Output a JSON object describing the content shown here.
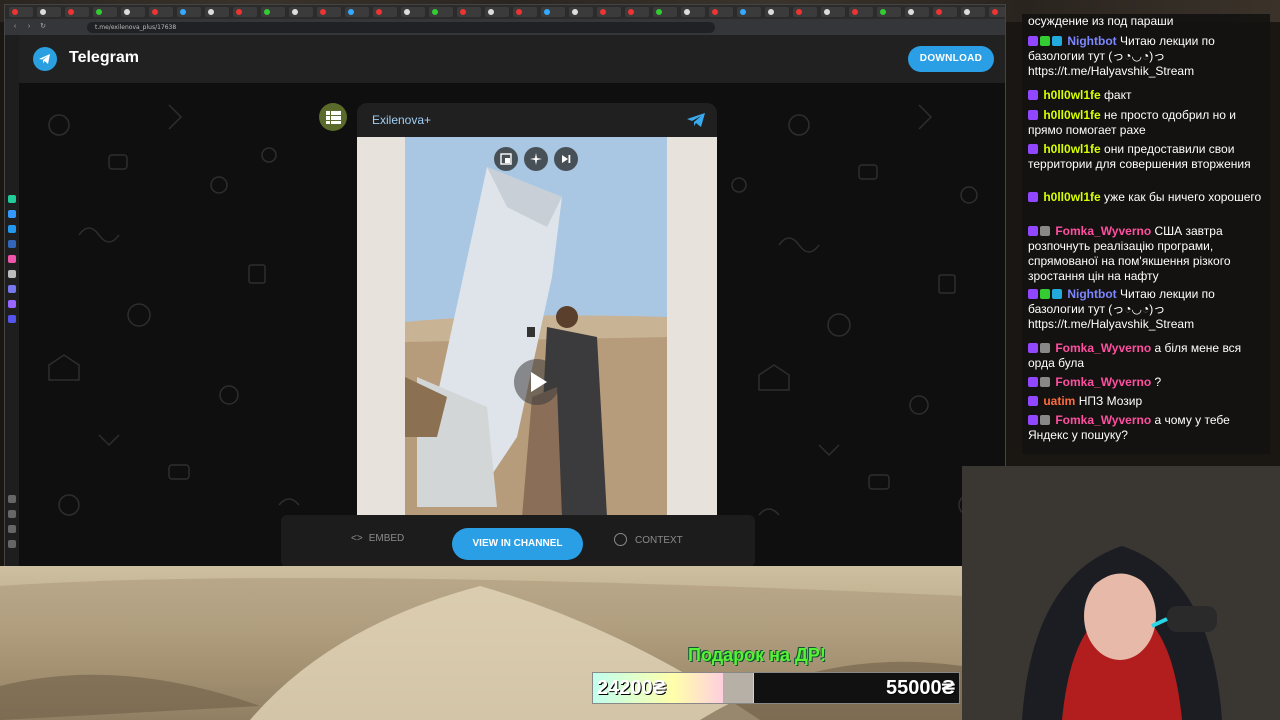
{
  "browser": {
    "url": "t.me/exilenova_plus/17638"
  },
  "telegram": {
    "app_title": "Telegram",
    "download_label": "DOWNLOAD",
    "post": {
      "channel_name": "Exilenova+"
    },
    "actions": {
      "embed_label": "EMBED",
      "view_in_channel_label": "VIEW IN CHANNEL",
      "context_label": "CONTEXT"
    },
    "accent_color": "#2a9fe6"
  },
  "chat": {
    "messages": [
      {
        "user": "",
        "text": "осуждение из под параши",
        "user_color": "#ffffff"
      },
      {
        "user": "Nightbot",
        "text": "Читаю лекции по базологии тут (っ◔◡◔)っ https://t.me/Halyavshik_Stream",
        "user_color": "#7c87ff"
      },
      {
        "user": "h0ll0wl1fe",
        "text": "факт",
        "user_color": "#d8ff00"
      },
      {
        "user": "h0ll0wl1fe",
        "text": "не просто одобрил но и прямо помогает рахе",
        "user_color": "#d8ff00"
      },
      {
        "user": "h0ll0wl1fe",
        "text": "они предоставили свои территории для совершения вторжения",
        "user_color": "#d8ff00"
      },
      {
        "user": "h0ll0wl1fe",
        "text": "уже как бы ничего хорошего",
        "user_color": "#d8ff00"
      },
      {
        "user": "Fomka_Wyverno",
        "text": "США завтра розпочнуть реалізацію програми, спрямованої на пом'якшення різкого зростання цін на нафту",
        "user_color": "#ff4fa0"
      },
      {
        "user": "Nightbot",
        "text": "Читаю лекции по базологии тут (っ◔◡◔)っ https://t.me/Halyavshik_Stream",
        "user_color": "#7c87ff"
      },
      {
        "user": "Fomka_Wyverno",
        "text": "а біля мене вся орда була",
        "user_color": "#ff4fa0"
      },
      {
        "user": "Fomka_Wyverno",
        "text": "?",
        "user_color": "#ff4fa0"
      },
      {
        "user": "uatim",
        "text": "НПЗ Мозир",
        "user_color": "#ff6b3d"
      },
      {
        "user": "Fomka_Wyverno",
        "text": "а чому у тебе Яндекс у пошуку?",
        "user_color": "#ff4fa0"
      }
    ]
  },
  "donation": {
    "title": "Подарок на ДР!",
    "current": "24200₴",
    "goal": "55000₴",
    "progress": 0.44
  }
}
